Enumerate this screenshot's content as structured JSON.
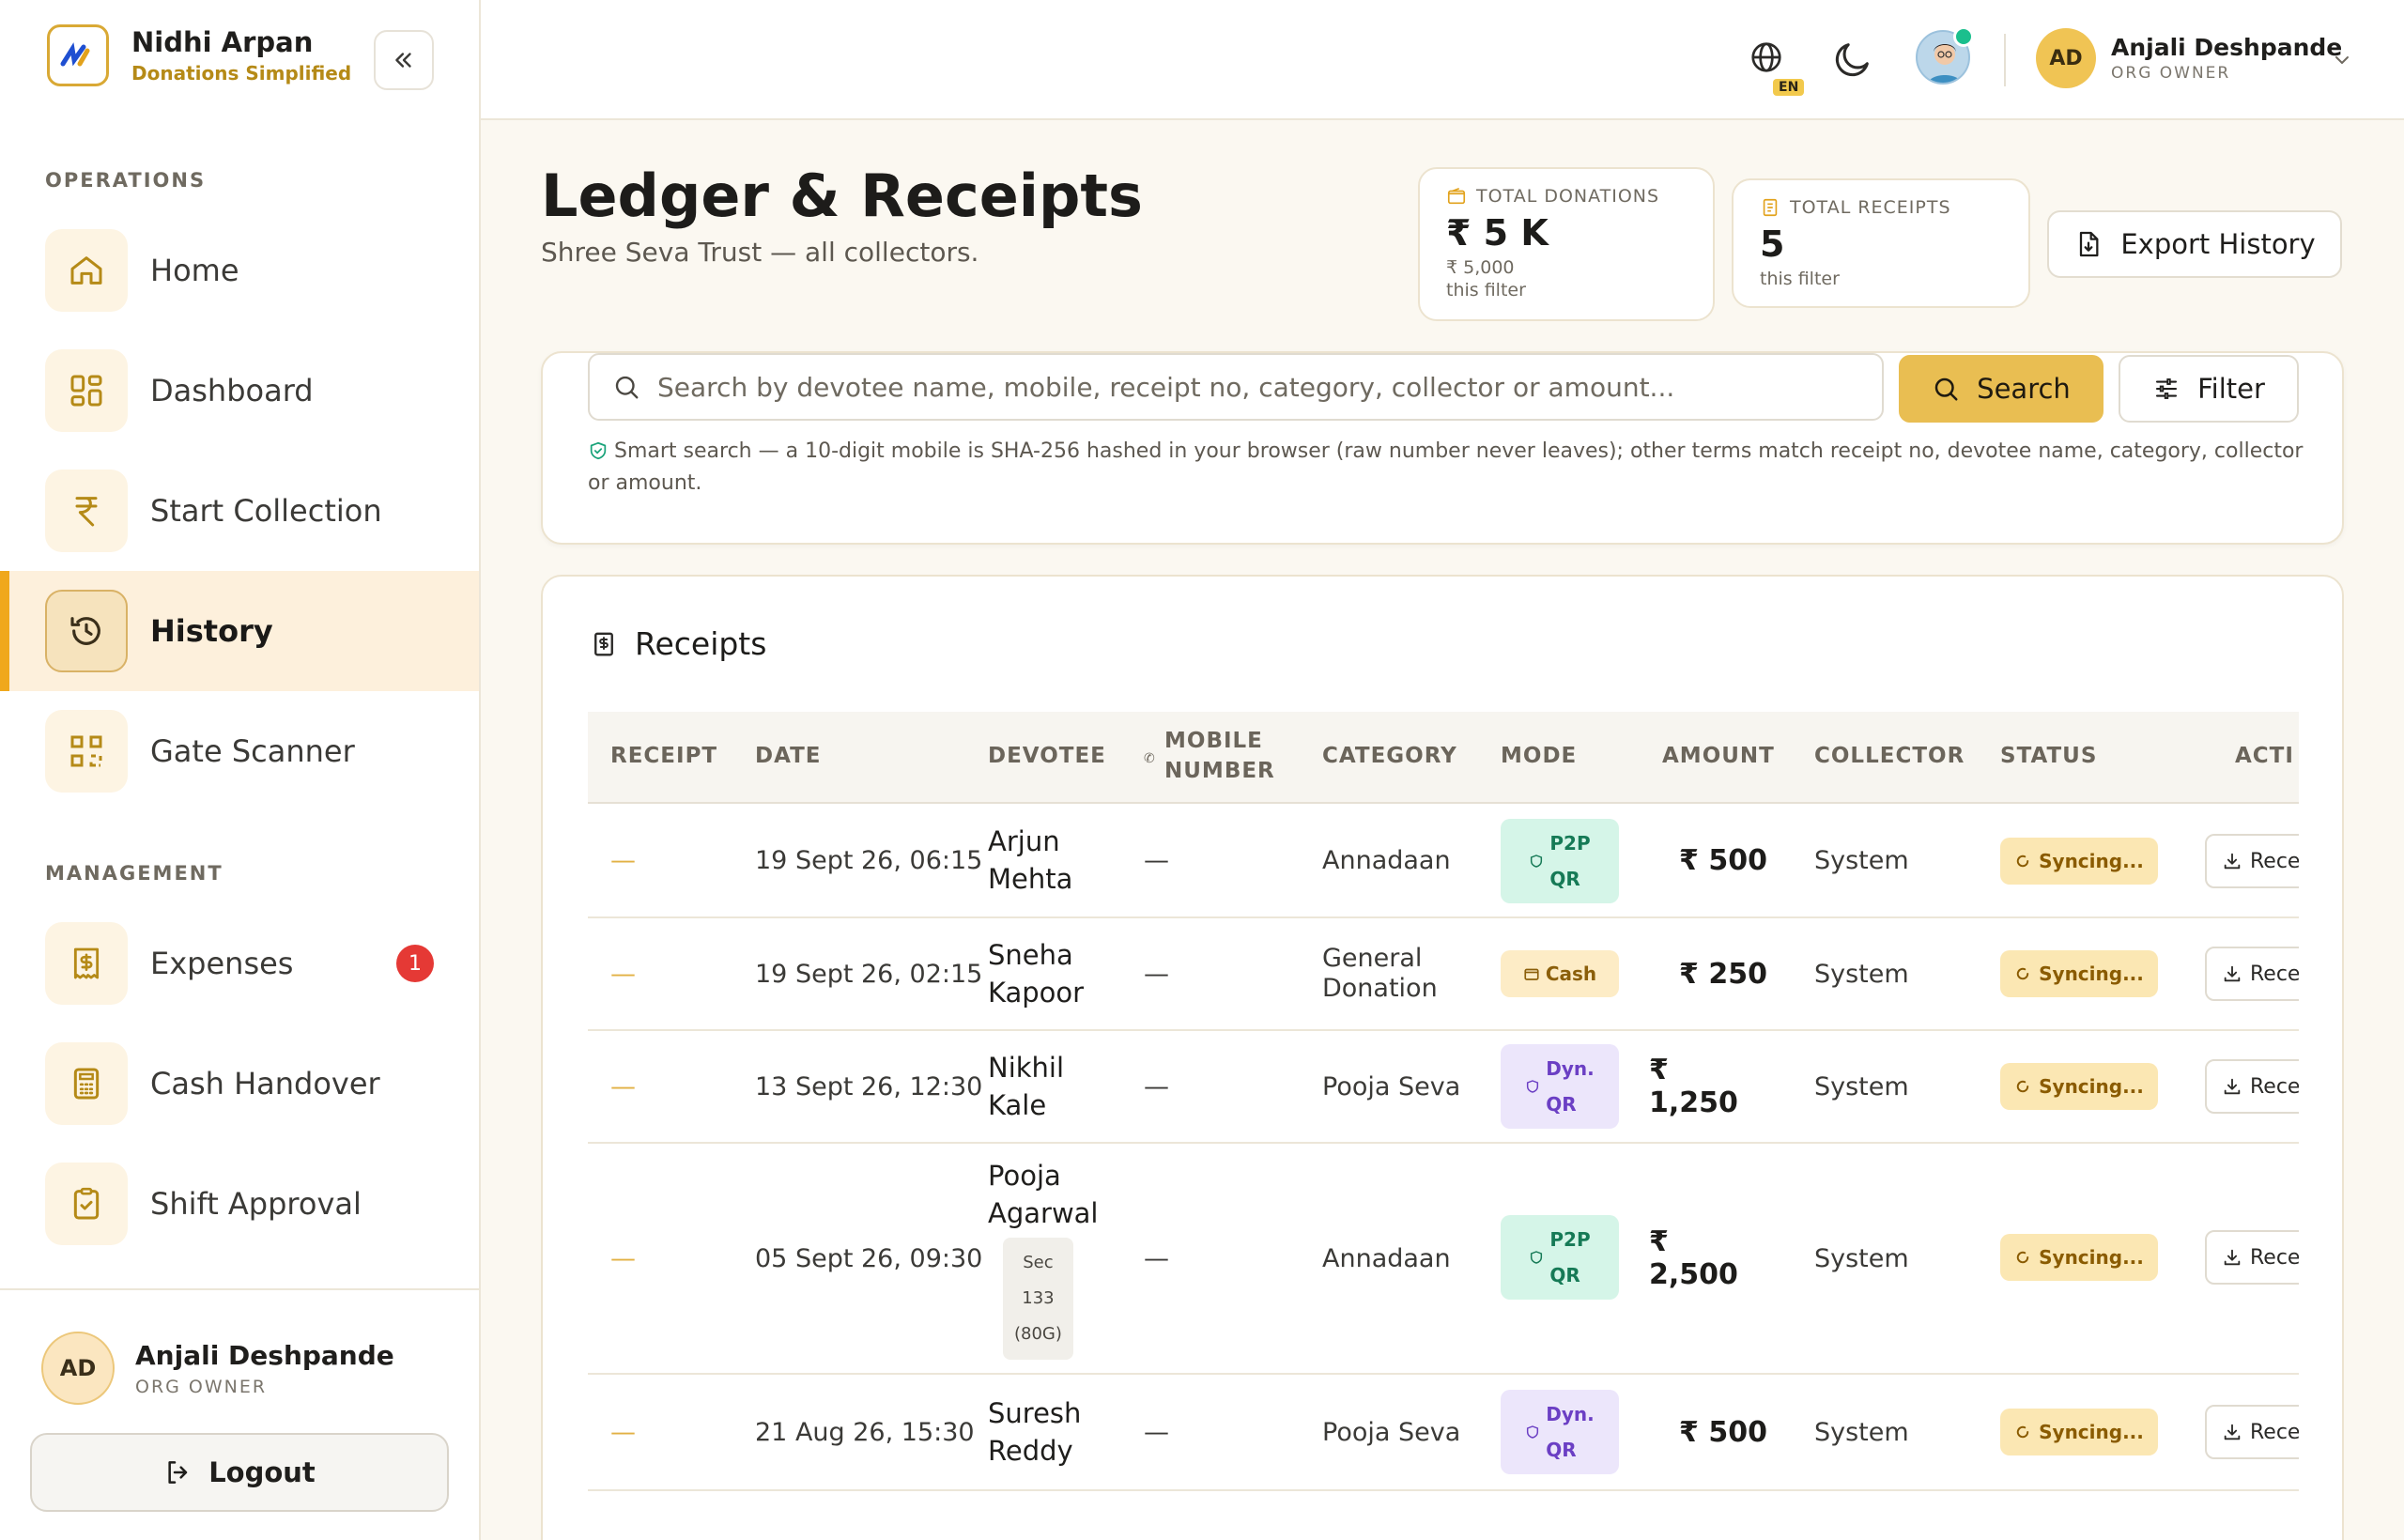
{
  "brand": {
    "name": "Nidhi Arpan",
    "tagline": "Donations Simplified"
  },
  "sidebar": {
    "sections": [
      {
        "label": "OPERATIONS"
      },
      {
        "label": "MANAGEMENT"
      }
    ],
    "operations": [
      {
        "label": "Home",
        "icon": "home-icon"
      },
      {
        "label": "Dashboard",
        "icon": "grid-icon"
      },
      {
        "label": "Start Collection",
        "icon": "rupee-icon"
      },
      {
        "label": "History",
        "icon": "history-icon",
        "active": true
      },
      {
        "label": "Gate Scanner",
        "icon": "qr-icon"
      }
    ],
    "management": [
      {
        "label": "Expenses",
        "icon": "receipt-icon",
        "badge": "1"
      },
      {
        "label": "Cash Handover",
        "icon": "calculator-icon"
      },
      {
        "label": "Shift Approval",
        "icon": "clipboard-check-icon"
      }
    ],
    "footer": {
      "initials": "AD",
      "name": "Anjali Deshpande",
      "role": "ORG OWNER",
      "logout_label": "Logout"
    }
  },
  "topbar": {
    "language": "EN",
    "user": {
      "initials": "AD",
      "name": "Anjali Deshpande",
      "role": "ORG OWNER"
    }
  },
  "page": {
    "title": "Ledger & Receipts",
    "subtitle": "Shree Seva Trust — all collectors.",
    "export_label": "Export History"
  },
  "stats": {
    "donations": {
      "label": "TOTAL DONATIONS",
      "value": "₹ 5 K",
      "exact": "₹ 5,000",
      "note": "this filter"
    },
    "receipts": {
      "label": "TOTAL RECEIPTS",
      "value": "5",
      "note": "this filter"
    }
  },
  "search": {
    "placeholder": "Search by devotee name, mobile, receipt no, category, collector or amount...",
    "search_label": "Search",
    "filter_label": "Filter",
    "hint": "Smart search — a 10-digit mobile is SHA-256 hashed in your browser (raw number never leaves); other terms match receipt no, devotee name, category, collector or amount."
  },
  "receipts": {
    "title": "Receipts",
    "columns": {
      "receipt": "RECEIPT",
      "date": "DATE",
      "devotee": "DEVOTEE",
      "mobile_1": "MOBILE",
      "mobile_2": "NUMBER",
      "category": "CATEGORY",
      "mode": "MODE",
      "amount": "AMOUNT",
      "collector": "COLLECTOR",
      "status": "STATUS",
      "action": "ACTI"
    },
    "rows": [
      {
        "receipt": "—",
        "date": "19 Sept 26, 06:15",
        "devotee_1": "Arjun",
        "devotee_2": "Mehta",
        "mobile": "—",
        "category_1": "Annadaan",
        "category_2": "",
        "mode_1": "P2P",
        "mode_2": "QR",
        "amount": "₹ 500",
        "collector": "System",
        "status": "Syncing...",
        "action": "Rece"
      },
      {
        "receipt": "—",
        "date": "19 Sept 26, 02:15",
        "devotee_1": "Sneha",
        "devotee_2": "Kapoor",
        "mobile": "—",
        "category_1": "General",
        "category_2": "Donation",
        "mode_1": "Cash",
        "mode_2": "",
        "amount": "₹ 250",
        "collector": "System",
        "status": "Syncing...",
        "action": "Rece"
      },
      {
        "receipt": "—",
        "date": "13 Sept 26, 12:30",
        "devotee_1": "Nikhil",
        "devotee_2": "Kale",
        "mobile": "—",
        "category_1": "Pooja Seva",
        "category_2": "",
        "mode_1": "Dyn.",
        "mode_2": "QR",
        "amount": "₹ 1,250",
        "collector": "System",
        "status": "Syncing...",
        "action": "Rece"
      },
      {
        "receipt": "—",
        "date": "05 Sept 26, 09:30",
        "devotee_1": "Pooja",
        "devotee_2": "Agarwal",
        "sec_1": "Sec",
        "sec_2": "133",
        "sec_3": "(80G)",
        "mobile": "—",
        "category_1": "Annadaan",
        "category_2": "",
        "mode_1": "P2P",
        "mode_2": "QR",
        "amount": "₹ 2,500",
        "collector": "System",
        "status": "Syncing...",
        "action": "Rece"
      },
      {
        "receipt": "—",
        "date": "21 Aug 26, 15:30",
        "devotee_1": "Suresh",
        "devotee_2": "Reddy",
        "mobile": "—",
        "category_1": "Pooja Seva",
        "category_2": "",
        "mode_1": "Dyn.",
        "mode_2": "QR",
        "amount": "₹ 500",
        "collector": "System",
        "status": "Syncing...",
        "action": "Rece"
      }
    ]
  },
  "colors": {
    "accent": "#e9be52",
    "active_bar": "#f0a81c",
    "badge": "#e53935"
  }
}
